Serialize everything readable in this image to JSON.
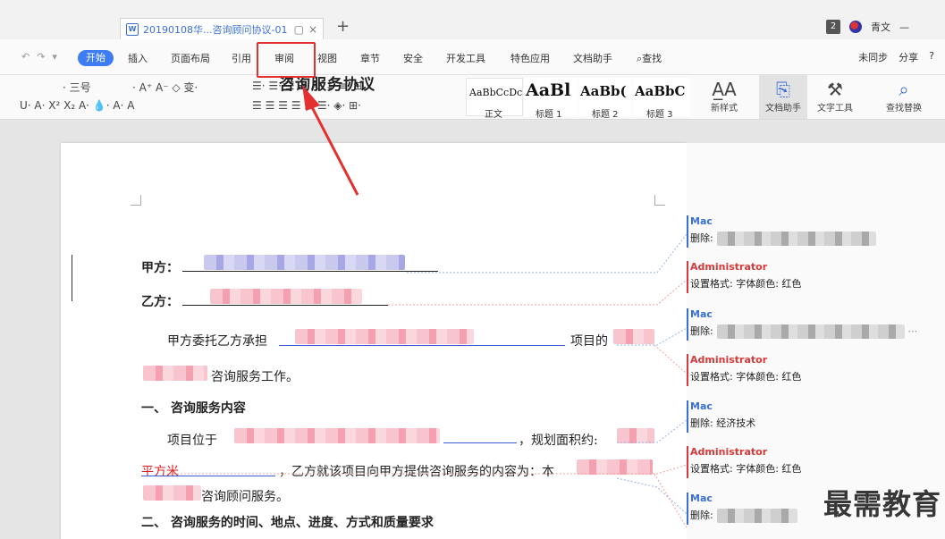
{
  "tab": {
    "title": "20190108华...咨询顾问协议-01",
    "pin": "▢",
    "close": "×",
    "new_tab": "+"
  },
  "window": {
    "badge": "2",
    "user": "青文"
  },
  "menu": {
    "start": "开始",
    "items": [
      "插入",
      "页面布局",
      "引用",
      "审阅",
      "视图",
      "章节",
      "安全",
      "开发工具",
      "特色应用",
      "文档助手",
      "查找"
    ],
    "right": [
      "未同步",
      "分享",
      "?"
    ]
  },
  "ribbon": {
    "font_size": "三号",
    "styles": [
      {
        "preview": "AaBbCcDc",
        "caption": "正文"
      },
      {
        "preview": "AaBl",
        "caption": "标题 1"
      },
      {
        "preview": "AaBb(",
        "caption": "标题 2"
      },
      {
        "preview": "AaBbC",
        "caption": "标题 3"
      }
    ],
    "new_style": "新样式",
    "doc_assistant": "文档助手",
    "text_tools": "文字工具",
    "find_replace": "查找替换"
  },
  "document": {
    "title": "咨询服务协议",
    "party_a": "甲方：",
    "party_b": "乙方：",
    "para1_a": "甲方委托乙方承担",
    "para1_b": "项目的",
    "para1_c": "咨询服务工作。",
    "section1": "一、 咨询服务内容",
    "para2_a": "项目位于",
    "para2_b": "，规划面积约:",
    "para3_red": "平方米",
    "para3_b": "，乙方就该项目向甲方提供咨询服务的内容为：本",
    "para4": "咨询顾问服务。",
    "section2": "二、 咨询服务的时间、地点、进度、方式和质量要求"
  },
  "comments": [
    {
      "author": "Mac",
      "label": "删除:",
      "text": ""
    },
    {
      "author": "Administrator",
      "label": "",
      "text": "设置格式: 字体颜色: 红色"
    },
    {
      "author": "Mac",
      "label": "删除:",
      "text": ""
    },
    {
      "author": "Administrator",
      "label": "",
      "text": "设置格式: 字体颜色: 红色"
    },
    {
      "author": "Mac",
      "label": "删除:",
      "text": "经济技术"
    },
    {
      "author": "Administrator",
      "label": "",
      "text": "设置格式: 字体颜色: 红色"
    },
    {
      "author": "Mac",
      "label": "删除:",
      "text": ""
    }
  ],
  "watermark": "最需教育"
}
